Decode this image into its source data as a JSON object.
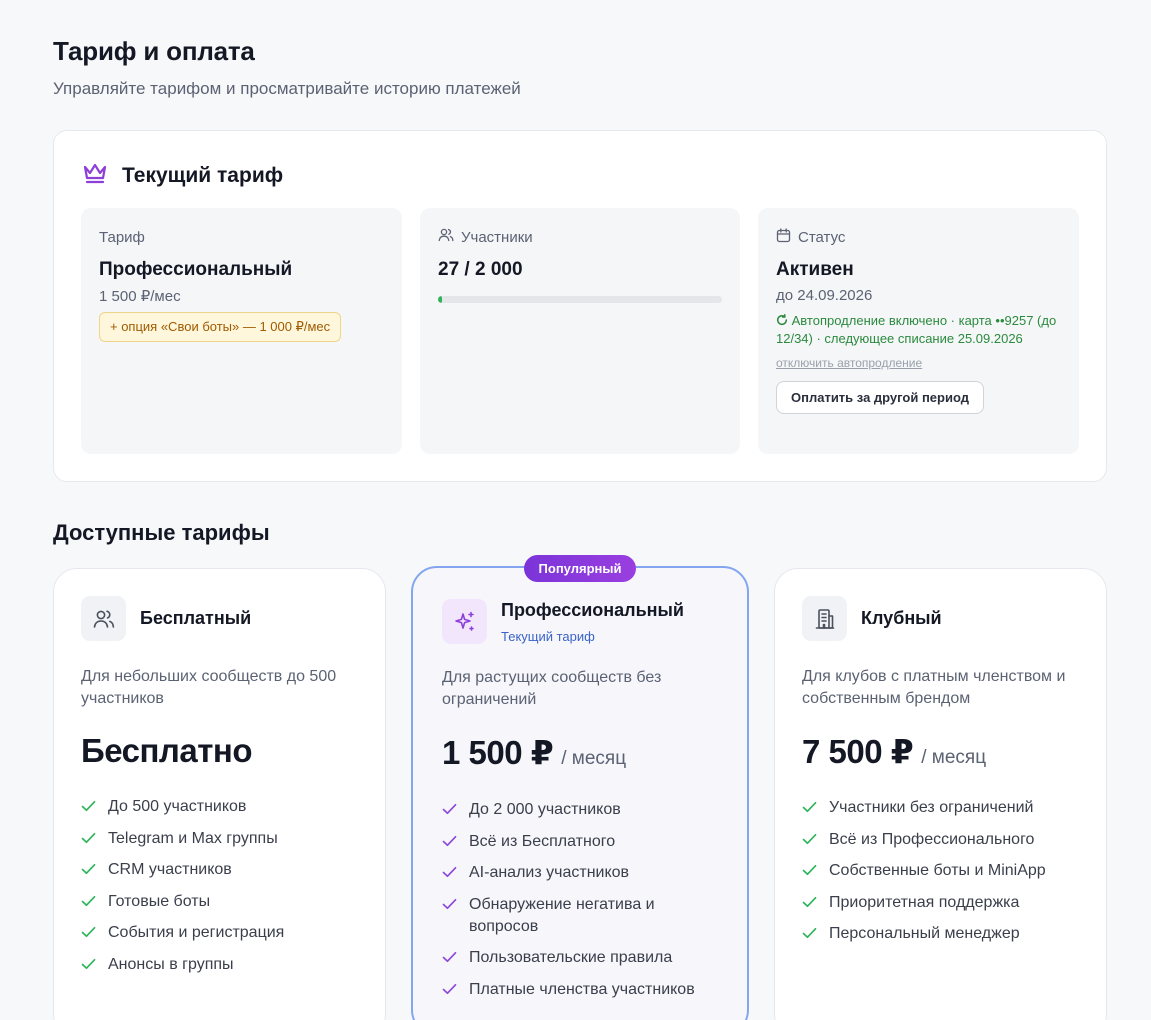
{
  "header": {
    "title": "Тариф и оплата",
    "subtitle": "Управляйте тарифом и просматривайте историю платежей"
  },
  "current": {
    "title": "Текущий тариф",
    "plan": {
      "label": "Тариф",
      "value": "Профессиональный",
      "price": "1 500 ₽/мес",
      "addon": "+ опция «Свои боты» — 1 000 ₽/мес"
    },
    "members": {
      "label": "Участники",
      "value": "27 / 2 000",
      "progress_fraction": 0.0135
    },
    "status": {
      "label": "Статус",
      "value": "Активен",
      "until": "до 24.09.2026",
      "autorenew": "Автопродление включено · карта ••9257 (до 12/34) · следующее списание 25.09.2026",
      "disable_link": "отключить автопродление",
      "pay_button": "Оплатить за другой период"
    }
  },
  "plans_section": {
    "title": "Доступные тарифы",
    "popular_badge": "Популярный",
    "plans": [
      {
        "name": "Бесплатный",
        "icon": "users-icon",
        "description": "Для небольших сообществ до 500 участников",
        "price": "Бесплатно",
        "period": "",
        "features": [
          "До 500 участников",
          "Telegram и Max группы",
          "CRM участников",
          "Готовые боты",
          "События и регистрация",
          "Анонсы в группы"
        ]
      },
      {
        "name": "Профессиональный",
        "icon": "sparkles-icon",
        "current_label": "Текущий тариф",
        "description": "Для растущих сообществ без ограничений",
        "price": "1 500 ₽",
        "period": "/ месяц",
        "features": [
          "До 2 000 участников",
          "Всё из Бесплатного",
          "AI-анализ участников",
          "Обнаружение негатива и вопросов",
          "Пользовательские правила",
          "Платные членства участников"
        ]
      },
      {
        "name": "Клубный",
        "icon": "building-icon",
        "description": "Для клубов с платным членством и собственным брендом",
        "price": "7 500 ₽",
        "period": "/ месяц",
        "features": [
          "Участники без ограничений",
          "Всё из Профессионального",
          "Собственные боты и MiniApp",
          "Приоритетная поддержка",
          "Персональный менеджер"
        ]
      }
    ]
  },
  "colors": {
    "accent_purple": "#7b34d8",
    "check_green": "#2fb45c",
    "check_purple": "#8e4ad8",
    "highlight_border": "#84a6f0",
    "autorenew_green": "#2b8a3e",
    "addon_text": "#a05a00"
  }
}
